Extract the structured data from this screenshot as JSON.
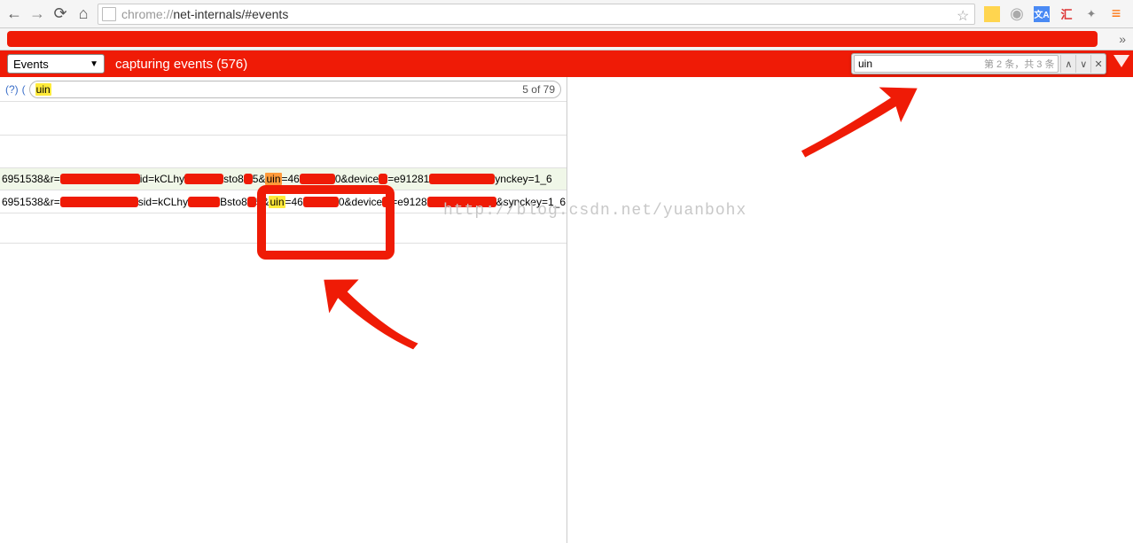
{
  "url": {
    "prefix": "chrome://",
    "path": "net-internals/#events"
  },
  "events_bar": {
    "select_label": "Events",
    "status": "capturing events (576)"
  },
  "find": {
    "value": "uin",
    "count": "第 2 条，共 3 条"
  },
  "filter": {
    "help": "(?)",
    "value": "uin",
    "count": "5 of 79"
  },
  "rows": [
    {
      "pre": "6951538&r=",
      "mid1": "id=kCLhy",
      "mid2": "sto8",
      "mid3": "5&",
      "hl": "uin",
      "post1": "=46",
      "post2": "0&device",
      "post3": "=e91281",
      "post4": "ynckey=1_6",
      "hl_cls": "hl-orange"
    },
    {
      "pre": "6951538&r=",
      "mid1": "sid=kCLhy",
      "mid2": "Bsto8",
      "mid3": "5&",
      "hl": "uin",
      "post1": "=46",
      "post2": "0&device",
      "post3": "=e9128",
      "post4": "&synckey=1_6",
      "hl_cls": "hl-yellow"
    }
  ],
  "watermark": "http://blog.csdn.net/yuanbohx"
}
